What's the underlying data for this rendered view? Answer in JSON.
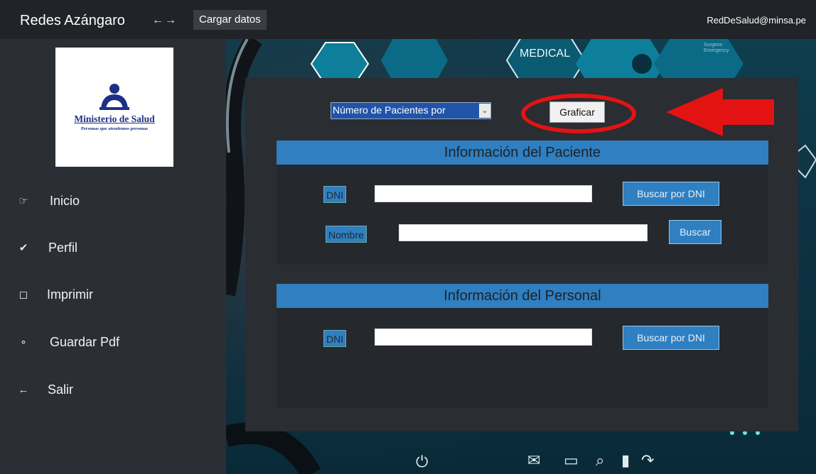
{
  "header": {
    "app_title": "Redes Azángaro",
    "nav_arrows": "←→",
    "load_button": "Cargar datos",
    "user_email": "RedDeSalud@minsa.pe"
  },
  "logo": {
    "title": "Ministerio de Salud",
    "subtitle": "Personas que atendemos personas",
    "brand_color": "#1e2f86"
  },
  "sidebar": {
    "items": [
      {
        "label": "Inicio",
        "icon": "pointing-hand-icon"
      },
      {
        "label": "Perfil",
        "icon": "profile-icon"
      },
      {
        "label": "Imprimir",
        "icon": "print-icon"
      },
      {
        "label": "Guardar Pdf",
        "icon": "save-pdf-icon"
      },
      {
        "label": "Salir",
        "icon": "exit-arrow-icon"
      }
    ]
  },
  "background": {
    "medical_label": "MEDICAL",
    "small_label": "Surgeon\nEmergency"
  },
  "chart_controls": {
    "selected_option": "Número de Pacientes por",
    "graph_button": "Graficar"
  },
  "patient_section": {
    "title": "Información del Paciente",
    "dni_label": "DNI",
    "dni_value": "",
    "search_dni_button": "Buscar por DNI",
    "name_label": "Nombre",
    "name_value": "",
    "search_button": "Buscar"
  },
  "staff_section": {
    "title": "Información del Personal",
    "dni_label": "DNI",
    "dni_value": "",
    "search_dni_button": "Buscar por DNI"
  },
  "colors": {
    "accent": "#2f7fc1",
    "highlight": "#e31313",
    "sidebar_bg": "#2b2f35",
    "topbar_bg": "#202327"
  }
}
